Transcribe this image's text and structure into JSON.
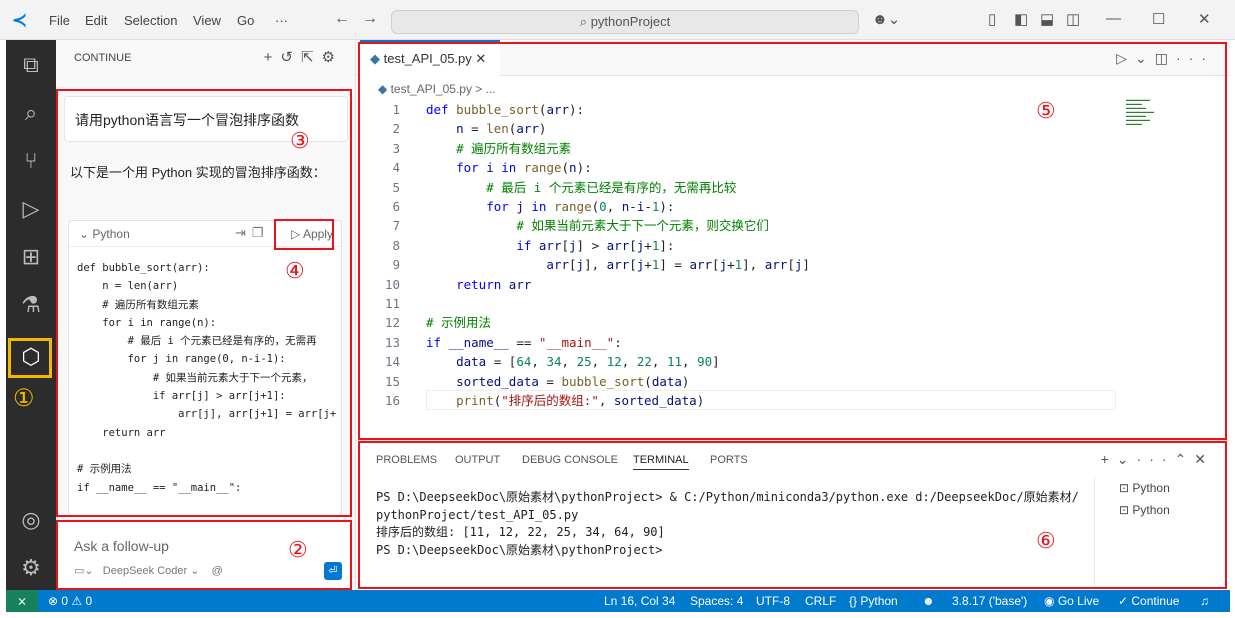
{
  "title_bar": {
    "menus": [
      "File",
      "Edit",
      "Selection",
      "View",
      "Go",
      "···"
    ],
    "search_text": "pythonProject"
  },
  "sidebar": {
    "title": "CONTINUE",
    "prompt": "请用python语言写一个冒泡排序函数",
    "answer": "以下是一个用 Python 实现的冒泡排序函数：",
    "code_lang": "Python",
    "apply_label": "Apply",
    "code": "def bubble_sort(arr):\n    n = len(arr)\n    # 遍历所有数组元素\n    for i in range(n):\n        # 最后 i 个元素已经是有序的，无需再\n        for j in range(0, n-i-1):\n            # 如果当前元素大于下一个元素，\n            if arr[j] > arr[j+1]:\n                arr[j], arr[j+1] = arr[j+\n    return arr\n\n# 示例用法\nif __name__ == \"__main__\":",
    "followup_placeholder": "Ask a follow-up",
    "model": "DeepSeek Coder",
    "at_symbol": "@"
  },
  "annotations": {
    "n1": "①",
    "n2": "②",
    "n3": "③",
    "n4": "④",
    "n5": "⑤",
    "n6": "⑥"
  },
  "editor": {
    "tab_label": "test_API_05.py",
    "breadcrumb": "test_API_05.py  >  ...",
    "line_numbers": [
      "1",
      "2",
      "3",
      "4",
      "5",
      "6",
      "7",
      "8",
      "9",
      "10",
      "11",
      "12",
      "13",
      "14",
      "15",
      "16"
    ]
  },
  "panel": {
    "tabs": [
      "PROBLEMS",
      "OUTPUT",
      "DEBUG CONSOLE",
      "TERMINAL",
      "PORTS"
    ],
    "active_tab": "TERMINAL",
    "terminal_lines": [
      "PS D:\\DeepseekDoc\\原始素材\\pythonProject> & C:/Python/miniconda3/python.exe d:/DeepseekDoc/原始素材/",
      "pythonProject/test_API_05.py",
      "排序后的数组: [11, 12, 22, 25, 34, 64, 90]",
      "PS D:\\DeepseekDoc\\原始素材\\pythonProject>"
    ],
    "terminal_list": [
      "Python",
      "Python"
    ]
  },
  "status_bar": {
    "problems": "⊗ 0 ⚠ 0",
    "position": "Ln 16, Col 34",
    "spaces": "Spaces: 4",
    "encoding": "UTF-8",
    "eol": "CRLF",
    "language": "{} Python",
    "interpreter": "3.8.17 ('base')",
    "go_live": "Go Live",
    "continue": "✓ Continue"
  }
}
